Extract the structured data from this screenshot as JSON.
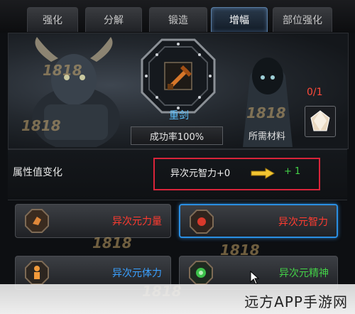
{
  "tabs": [
    {
      "label": "强化"
    },
    {
      "label": "分解"
    },
    {
      "label": "锻造"
    },
    {
      "label": "增幅",
      "active": true
    },
    {
      "label": "部位强化"
    }
  ],
  "watermarks": [
    "1818",
    "1818",
    "1818",
    "1818",
    "1818",
    "1818"
  ],
  "item": {
    "name": "重剑",
    "icon": "sword-icon",
    "success_rate": "成功率100%"
  },
  "material": {
    "count": "0/1",
    "label": "所需材料",
    "icon": "crystal-icon"
  },
  "attribute_change": {
    "label": "属性值变化",
    "name": "异次元智力+0",
    "gain": "+ 1"
  },
  "stats": [
    {
      "label": "异次元力量",
      "color": "#ff3b30",
      "icon": "fist-icon"
    },
    {
      "label": "异次元智力",
      "color": "#ff3b30",
      "icon": "orb-icon",
      "selected": true
    },
    {
      "label": "异次元体力",
      "color": "#3aa0ff",
      "icon": "body-icon"
    },
    {
      "label": "异次元精神",
      "color": "#43d147",
      "icon": "spirit-icon"
    }
  ],
  "site_watermark": "远方APP手游网",
  "colors": {
    "active_tab": "#5a7ea4",
    "highlight_border": "#d9243a",
    "selected_border": "#2a8fe3",
    "item_name": "#5cc2ff",
    "material_count": "#ff4a3a",
    "gain": "#43d147"
  }
}
